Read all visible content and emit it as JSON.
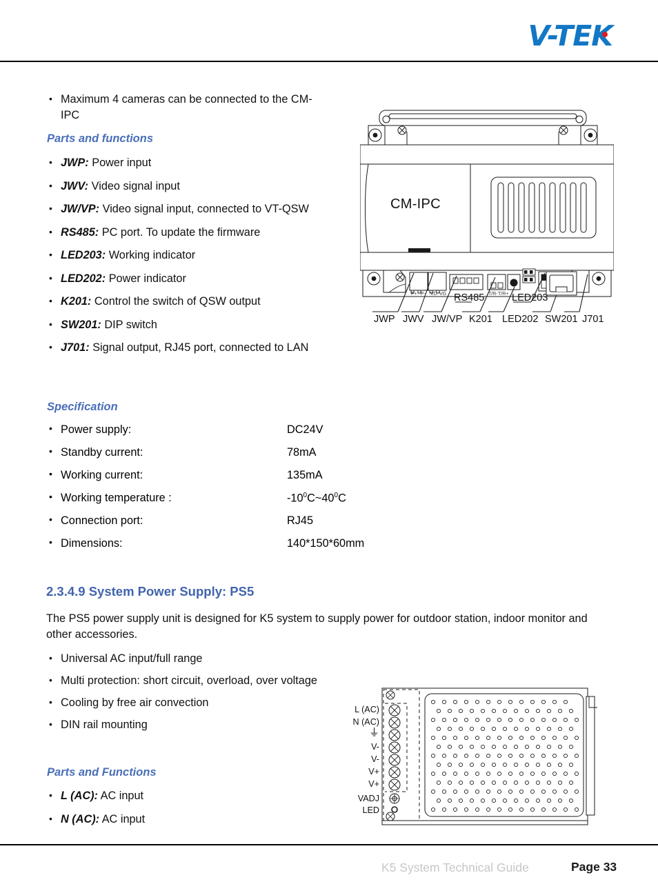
{
  "header": {
    "logo_text": "V-TEK",
    "logo_color": "#1277c4",
    "logo_accent_color": "#d81e1e"
  },
  "accent_colors": {
    "subheading_blue": "#4a6fb8",
    "section_blue": "#4264ae",
    "body_black": "#111111",
    "footer_gray": "#c7c7c7"
  },
  "cmipc_section": {
    "intro_bullets": [
      {
        "term": "",
        "text": "Maximum 4 cameras can be connected to the CM-IPC"
      }
    ],
    "parts_heading": "Parts and functions",
    "parts": [
      {
        "term": "JWP:",
        "text": "Power input"
      },
      {
        "term": "JWV:",
        "text": "Video signal input"
      },
      {
        "term": "JW/VP:",
        "text": "Video signal input, connected to VT-QSW"
      },
      {
        "term": "RS485:",
        "text": "PC port. To update the firmware"
      },
      {
        "term": "LED203:",
        "text": "Working indicator"
      },
      {
        "term": "LED202:",
        "text": "Power indicator"
      },
      {
        "term": "K201:",
        "text": "Control the switch of QSW output"
      },
      {
        "term": "SW201:",
        "text": "DIP switch"
      },
      {
        "term": "J701:",
        "text": "Signal output, RJ45 port, connected to LAN"
      }
    ],
    "spec_heading": "Specification",
    "specs": [
      {
        "label": "Power supply:",
        "value": "DC24V"
      },
      {
        "label": "Standby current:",
        "value": "78mA"
      },
      {
        "label": "Working current:",
        "value": "135mA"
      },
      {
        "label": "Working temperature :",
        "value": "-10°C~40°C",
        "value_pre": "-10",
        "value_sup1": "0",
        "value_mid": "C~40",
        "value_sup2": "0",
        "value_post": "C"
      },
      {
        "label": "Connection port:",
        "value": " RJ45"
      },
      {
        "label": "Dimensions:",
        "value": "140*150*60mm"
      }
    ]
  },
  "cmipc_figure": {
    "device_label": "CM-IPC",
    "terminal_micro_labels": [
      "P+",
      "P-",
      "VD",
      "VG",
      "T/R-",
      "T/R+"
    ],
    "inline_callouts": [
      "RS485",
      "LED203"
    ],
    "callouts": [
      "JWP",
      "JWV",
      "JW/VP",
      "K201",
      "LED202",
      "SW201",
      "J701"
    ]
  },
  "ps5_section": {
    "heading": "2.3.4.9 System Power Supply: PS5",
    "body": "The PS5 power supply unit is designed for K5 system to supply power for outdoor station, indoor monitor and other accessories.",
    "features": [
      "Universal AC input/full range",
      "Multi protection: short circuit, overload, over voltage",
      "Cooling by free air convection",
      "DIN rail mounting"
    ],
    "parts_heading": "Parts and Functions",
    "parts": [
      {
        "term": "L (AC):",
        "text": "AC input"
      },
      {
        "term": "N (AC):",
        "text": "AC input"
      }
    ]
  },
  "ps5_figure": {
    "terminals": [
      "L (AC)",
      "N (AC)",
      "⏚",
      "V-",
      "V-",
      "V+",
      "V+",
      "VADJ",
      "LED"
    ]
  },
  "footer": {
    "guide_text": "K5 System Technical Guide",
    "page_text": "Page 33"
  }
}
